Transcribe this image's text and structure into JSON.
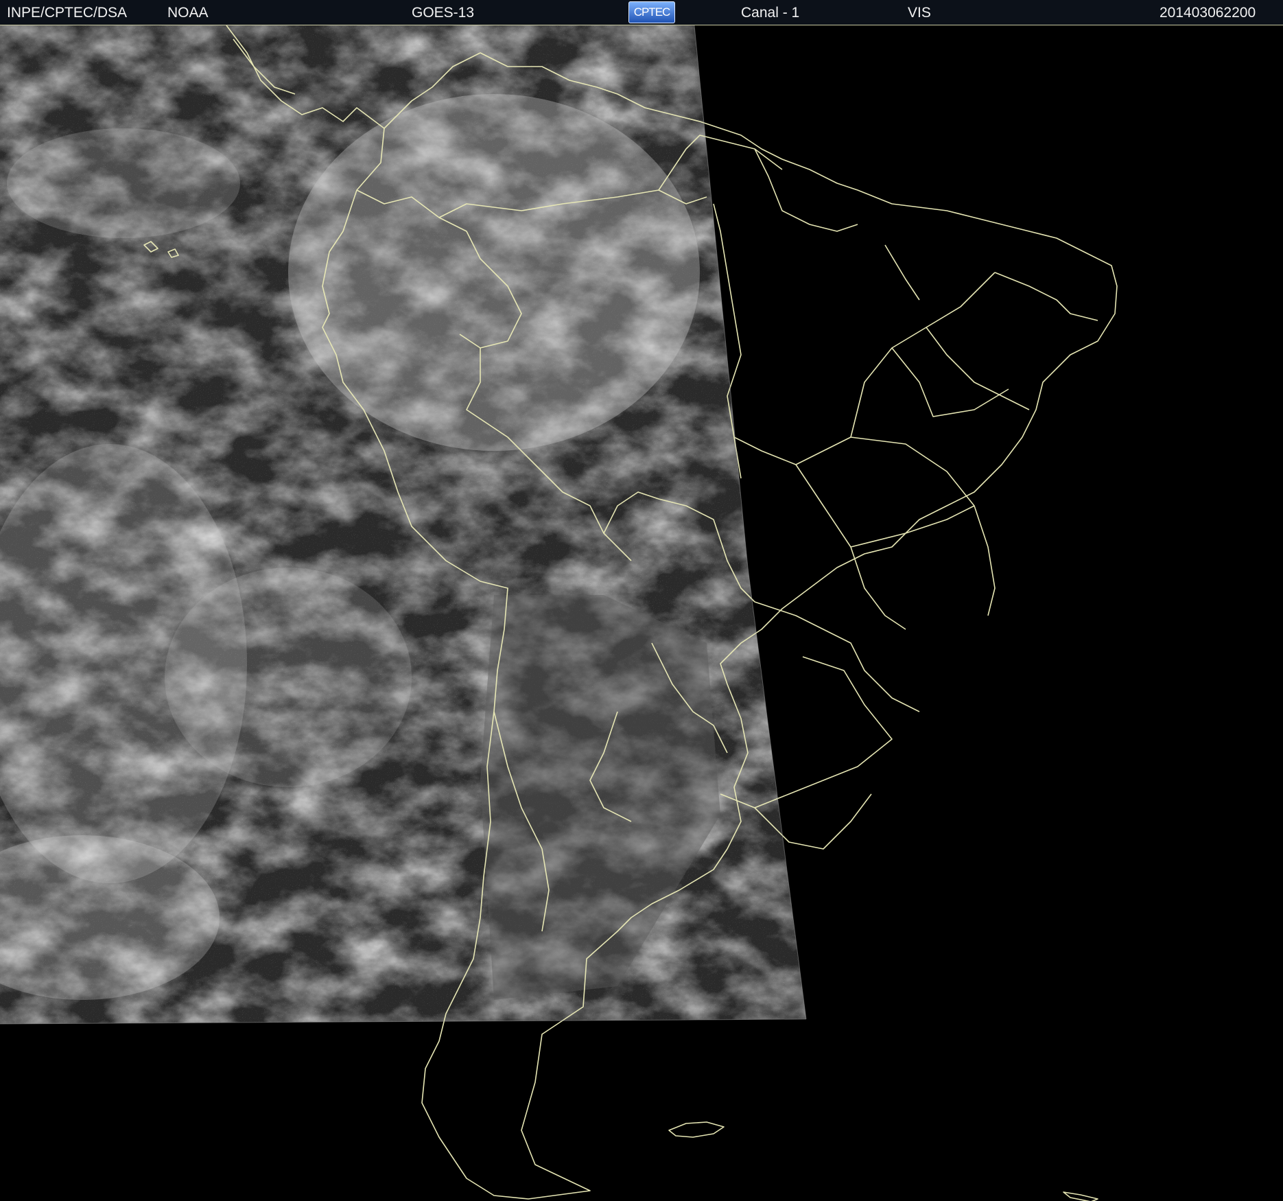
{
  "header": {
    "institution": "INPE/CPTEC/DSA",
    "agency": "NOAA",
    "satellite": "GOES-13",
    "logo_text": "CPTEC",
    "channel": "Canal - 1",
    "band": "VIS",
    "timestamp": "201403062200"
  },
  "colors": {
    "background": "#000000",
    "header_background": "#0c1119",
    "boundary_lines": "#e6e6b4"
  }
}
